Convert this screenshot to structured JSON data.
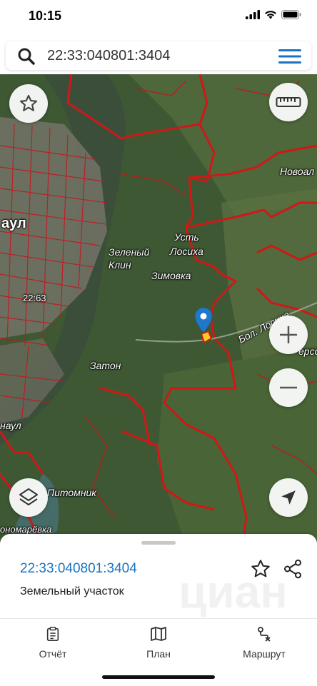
{
  "status_bar": {
    "time": "10:15"
  },
  "search": {
    "query": "22:33:040801:3404"
  },
  "map": {
    "labels": {
      "city": "аул",
      "zeleny_klin": "Зеленый\nКлин",
      "ust_losikha": "Усть\nЛосиха",
      "zimovka": "Зимовка",
      "zaton": "Затон",
      "number": "22:63",
      "novoal": "Новоал",
      "bol_losikha": "Бол. Лосиха",
      "naul": "наул",
      "pitomnik": "Питомник",
      "kondratyevka": "ономарёвка",
      "tersov": "ерсов"
    }
  },
  "sheet": {
    "parcel_id": "22:33:040801:3404",
    "parcel_type": "Земельный участок",
    "watermark": "циан"
  },
  "tabs": [
    {
      "label": "Отчёт",
      "icon": "report-icon"
    },
    {
      "label": "План",
      "icon": "map-plan-icon"
    },
    {
      "label": "Маршрут",
      "icon": "route-icon"
    }
  ],
  "colors": {
    "accent": "#1a73c0",
    "parcel_lines": "#d01818",
    "marker": "#2278c8"
  }
}
